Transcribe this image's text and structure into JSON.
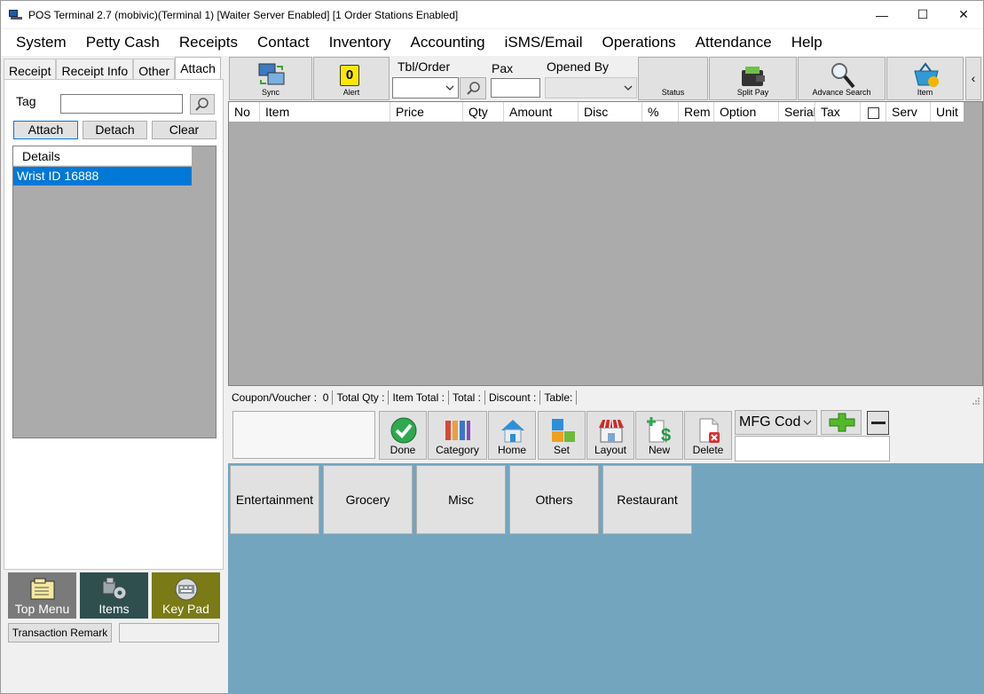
{
  "window": {
    "title": "POS Terminal 2.7 (mobivic)(Terminal 1) [Waiter Server Enabled] [1 Order Stations Enabled]",
    "minimize": "—",
    "maximize": "☐",
    "close": "✕"
  },
  "menu": [
    "System",
    "Petty Cash",
    "Receipts",
    "Contact",
    "Inventory",
    "Accounting",
    "iSMS/Email",
    "Operations",
    "Attendance",
    "Help"
  ],
  "left_tabs": [
    "Receipt",
    "Receipt Info",
    "Other",
    "Attach"
  ],
  "attach": {
    "tag_label": "Tag",
    "tag_value": "",
    "buttons": [
      "Attach",
      "Detach",
      "Clear"
    ],
    "details_header": "Details",
    "details_rows": [
      "Wrist ID 16888"
    ]
  },
  "nav_tiles": [
    "Top Menu",
    "Items",
    "Key Pad"
  ],
  "transaction_remark": "Transaction Remark",
  "toolbar": {
    "sync": "Sync",
    "alert": "Alert",
    "alert_count": "0",
    "tbl_order": "Tbl/Order",
    "pax": "Pax",
    "opened_by": "Opened By",
    "status": "Status",
    "split_pay": "Split Pay",
    "advance_search": "Advance Search",
    "item": "Item",
    "collapse": "‹"
  },
  "grid_columns": [
    "No",
    "Item",
    "Price",
    "Qty",
    "Amount",
    "Disc",
    "%",
    "Rem",
    "Option",
    "Serial",
    "Tax",
    "",
    "Serv",
    "Unit"
  ],
  "status_strip": {
    "coupon": "Coupon/Voucher :",
    "coupon_value": "0",
    "total_qty": "Total Qty :",
    "item_total": "Item Total :",
    "total": "Total :",
    "discount": "Discount :",
    "table": "Table:"
  },
  "actions": [
    "Done",
    "Category",
    "Home",
    "Set",
    "Layout",
    "New",
    "Delete"
  ],
  "mfg_select": "MFG Cod",
  "categories": [
    "Entertainment",
    "Grocery",
    "Misc",
    "Others",
    "Restaurant"
  ],
  "colors": {
    "tile_top_menu": "#7a7a7a",
    "tile_items": "#2f4f4f",
    "tile_key_pad": "#7a7a16",
    "category_bg": "#73a5bf",
    "grid_bg": "#ababab",
    "selection": "#0078d7"
  }
}
